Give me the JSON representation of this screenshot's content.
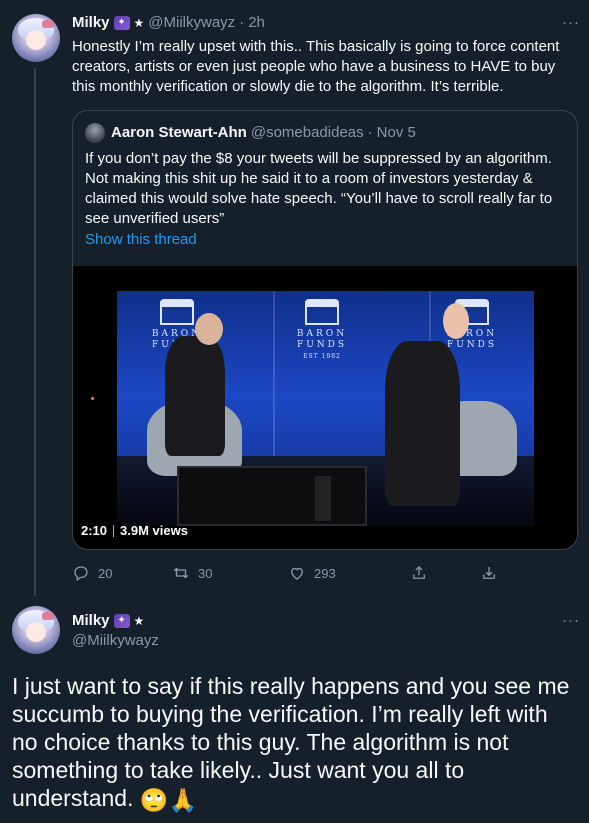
{
  "tweet1": {
    "author_name": "Milky",
    "handle": "@Miilkywayz",
    "time": "2h",
    "text": "Honestly I’m really upset with this.. This basically is going to force content creators, artists or even just people who have a business to HAVE to buy this monthly verification or slowly die to the algorithm. It’s terrible.",
    "more": "···"
  },
  "quoted": {
    "author_name": "Aaron Stewart-Ahn",
    "handle": "@somebadideas",
    "time": "Nov 5",
    "text": "If you don’t pay the $8 your tweets will be suppressed by an algorithm. Not making this shit up he said it to a room of investors yesterday & claimed this would solve hate speech. “You’ll have to scroll really far to see unverified users”",
    "show_thread": "Show this thread",
    "video": {
      "duration": "2:10",
      "views": "3.9M views",
      "logo_text_1": "BARON",
      "logo_text_2": "FUNDS",
      "logo_est": "EST 1982"
    }
  },
  "actions": {
    "replies": "20",
    "retweets": "30",
    "likes": "293"
  },
  "tweet2": {
    "author_name": "Milky",
    "handle": "@Miilkywayz",
    "more": "···",
    "text": "I just want to say if this really happens and you see me succumb to buying the verification. I’m really left with no choice thanks to this guy. The algorithm is not something to take likely.. Just want you all to understand.",
    "emojis": "🙄🙏"
  },
  "colors": {
    "background": "#15202b",
    "text": "#f7f9f9",
    "secondary": "#8b98a5",
    "accent": "#1d9bf0",
    "border": "#38444d"
  }
}
